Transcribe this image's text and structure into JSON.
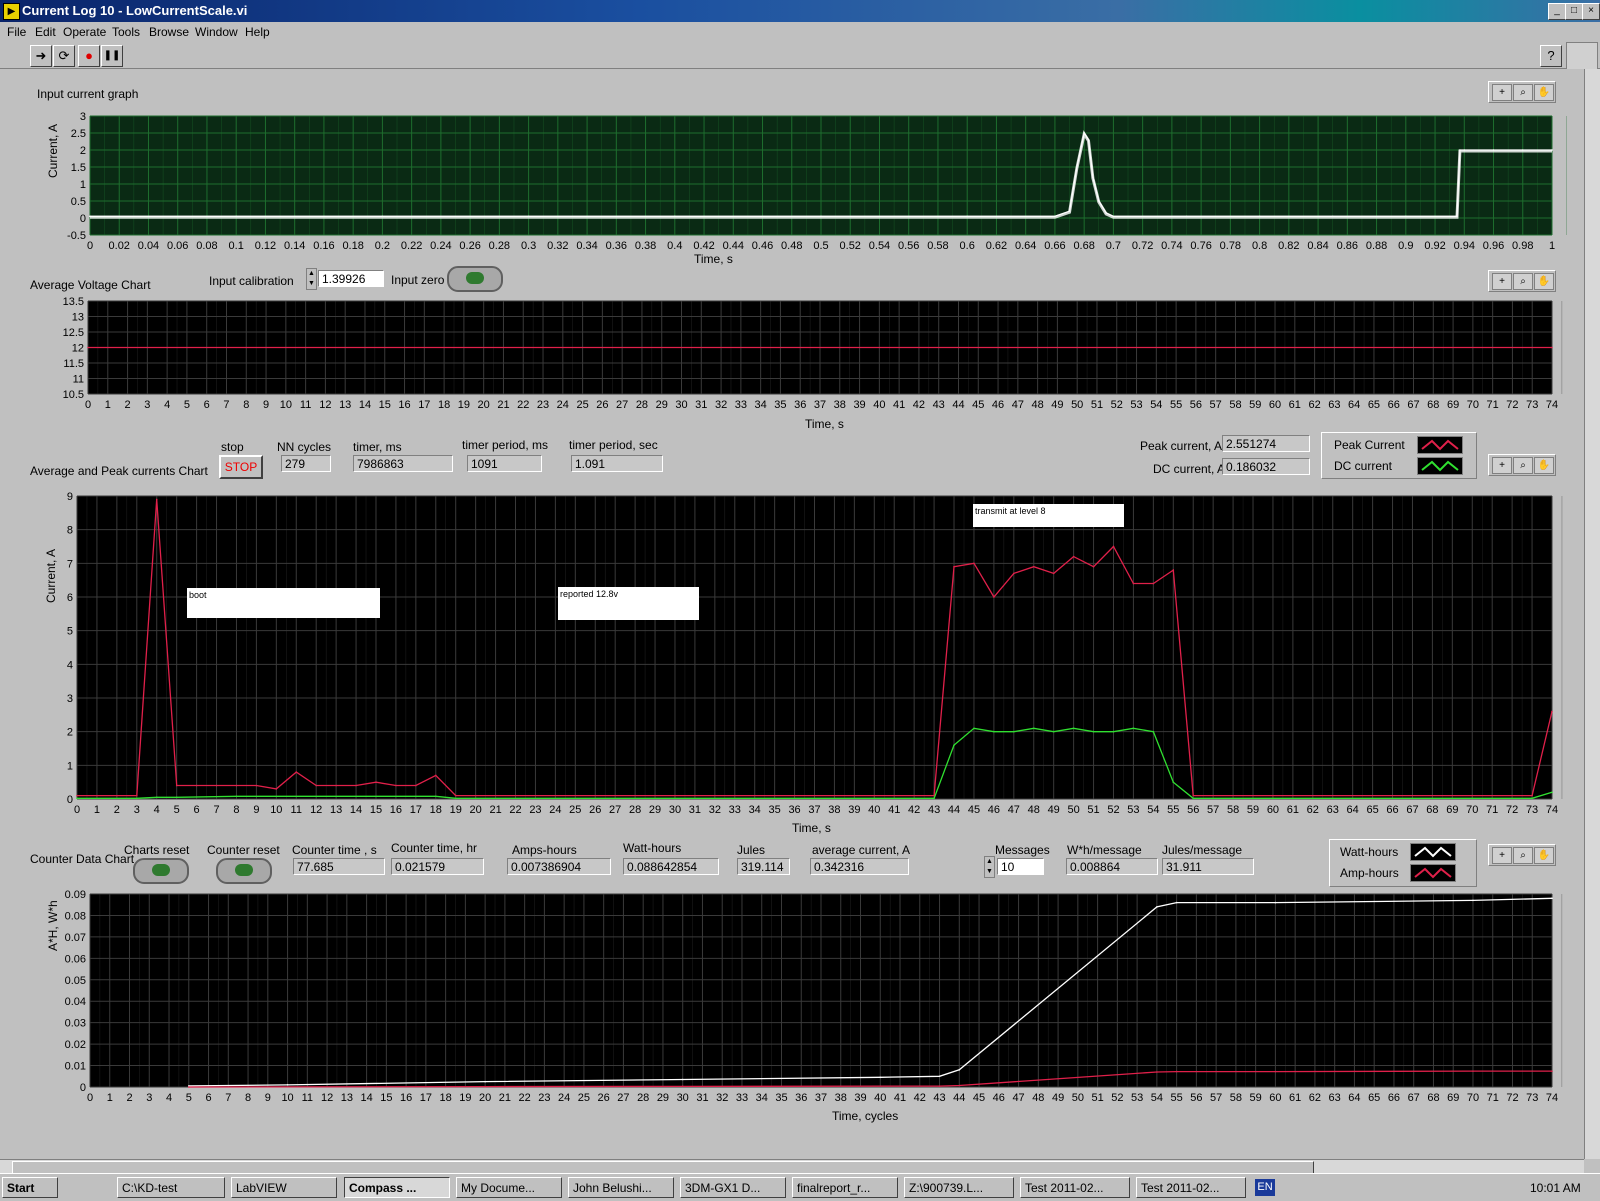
{
  "window": {
    "title": "Current Log 10 - LowCurrentScale.vi",
    "minimize": "_",
    "maximize": "□",
    "close": "×"
  },
  "menu": [
    "File",
    "Edit",
    "Operate",
    "Tools",
    "Browse",
    "Window",
    "Help"
  ],
  "toolbar": {
    "run": "➜",
    "run_continuous": "⟳",
    "abort": "●",
    "pause": "❚❚",
    "help": "?"
  },
  "graph1": {
    "title": "Input current graph",
    "chart_data": {
      "type": "line",
      "title": "Input current graph",
      "xlabel": "Time, s",
      "ylabel": "Current, A",
      "xlim": [
        0,
        1
      ],
      "ylim": [
        -0.5,
        3
      ],
      "xticks": [
        "0",
        "0.02",
        "0.04",
        "0.06",
        "0.08",
        "0.1",
        "0.12",
        "0.14",
        "0.16",
        "0.18",
        "0.2",
        "0.22",
        "0.24",
        "0.26",
        "0.28",
        "0.3",
        "0.32",
        "0.34",
        "0.36",
        "0.38",
        "0.4",
        "0.42",
        "0.44",
        "0.46",
        "0.48",
        "0.5",
        "0.52",
        "0.54",
        "0.56",
        "0.58",
        "0.6",
        "0.62",
        "0.64",
        "0.66",
        "0.68",
        "0.7",
        "0.72",
        "0.74",
        "0.76",
        "0.78",
        "0.8",
        "0.82",
        "0.84",
        "0.86",
        "0.88",
        "0.9",
        "0.92",
        "0.94",
        "0.96",
        "0.98",
        "1"
      ],
      "yticks": [
        "3",
        "2.5",
        "2",
        "1.5",
        "1",
        "0.5",
        "0",
        "-0.5"
      ],
      "series": [
        {
          "color": "#ffffff",
          "x": [
            0,
            0.1,
            0.2,
            0.3,
            0.4,
            0.5,
            0.6,
            0.66,
            0.67,
            0.675,
            0.68,
            0.683,
            0.686,
            0.69,
            0.695,
            0.7,
            0.75,
            0.8,
            0.85,
            0.9,
            0.935,
            0.937,
            0.94,
            0.96,
            0.98,
            1
          ],
          "y": [
            0.05,
            0.05,
            0.05,
            0.05,
            0.05,
            0.05,
            0.05,
            0.05,
            0.2,
            1.5,
            2.5,
            2.3,
            1.2,
            0.5,
            0.15,
            0.05,
            0.05,
            0.05,
            0.05,
            0.05,
            0.05,
            2.0,
            2.0,
            2.0,
            2.0,
            2.0
          ]
        }
      ]
    }
  },
  "graph2": {
    "title": "Average Voltage  Chart",
    "calibration_label": "Input calibration",
    "calibration_value": "1.39926",
    "zero_label": "Input zero",
    "chart_data": {
      "type": "line",
      "title": "Average Voltage  Chart",
      "xlabel": "Time, s",
      "ylabel": "",
      "xlim": [
        0,
        74
      ],
      "ylim": [
        10.5,
        13.5
      ],
      "yticks": [
        "13.5",
        "13",
        "12.5",
        "12",
        "11.5",
        "11",
        "10.5"
      ],
      "series": [
        {
          "color": "#e0204a",
          "x": [
            0,
            74
          ],
          "y": [
            12,
            12
          ]
        }
      ]
    }
  },
  "controls3": {
    "stop_label": "stop",
    "stop_button": "STOP",
    "nn_cycles_label": "NN cycles",
    "nn_cycles": "279",
    "timer_ms_label": "timer, ms",
    "timer_ms": "7986863",
    "timer_period_ms_label": "timer period, ms",
    "timer_period_ms": "1091",
    "timer_period_sec_label": "timer period, sec",
    "timer_period_sec": "1.091",
    "peak_label": "Peak current, A",
    "peak_value": "2.551274",
    "dc_label": "DC current, A",
    "dc_value": "0.186032",
    "legend": [
      "Peak Current",
      "DC current"
    ]
  },
  "graph3": {
    "title": "Average and Peak currents Chart",
    "notes": [
      "boot",
      "reported 12.8v",
      "transmit at level 8"
    ],
    "chart_data": {
      "type": "line",
      "title": "Average and Peak currents Chart",
      "xlabel": "Time, s",
      "ylabel": "Current, A",
      "xlim": [
        0,
        74
      ],
      "ylim": [
        0,
        9
      ],
      "yticks": [
        "9",
        "8",
        "7",
        "6",
        "5",
        "4",
        "3",
        "2",
        "1",
        "0"
      ],
      "series": [
        {
          "name": "Peak Current",
          "color": "#e0204a",
          "x": [
            0,
            1,
            2,
            3,
            4,
            5,
            6,
            7,
            8,
            9,
            10,
            11,
            12,
            13,
            14,
            15,
            16,
            17,
            18,
            19,
            20,
            30,
            40,
            43,
            44,
            45,
            46,
            47,
            48,
            49,
            50,
            51,
            52,
            53,
            54,
            55,
            56,
            60,
            70,
            73,
            74
          ],
          "y": [
            0.1,
            0.1,
            0.1,
            0.1,
            8.9,
            0.4,
            0.4,
            0.4,
            0.4,
            0.4,
            0.3,
            0.8,
            0.4,
            0.4,
            0.4,
            0.5,
            0.4,
            0.4,
            0.7,
            0.1,
            0.1,
            0.1,
            0.1,
            0.1,
            6.9,
            7.0,
            6.0,
            6.7,
            6.9,
            6.7,
            7.2,
            6.9,
            7.5,
            6.4,
            6.4,
            6.8,
            0.1,
            0.1,
            0.1,
            0.1,
            2.6
          ]
        },
        {
          "name": "DC current",
          "color": "#30e030",
          "x": [
            0,
            3,
            4,
            5,
            8,
            18,
            19,
            20,
            30,
            40,
            43,
            44,
            45,
            46,
            47,
            48,
            49,
            50,
            51,
            52,
            53,
            54,
            55,
            56,
            60,
            70,
            73,
            74
          ],
          "y": [
            0.02,
            0.02,
            0.05,
            0.05,
            0.08,
            0.08,
            0.02,
            0.02,
            0.02,
            0.02,
            0.02,
            1.6,
            2.1,
            2.0,
            2.0,
            2.1,
            2.0,
            2.1,
            2.0,
            2.0,
            2.1,
            2.0,
            0.5,
            0.02,
            0.02,
            0.02,
            0.02,
            0.2
          ]
        }
      ]
    }
  },
  "controls4": {
    "charts_reset_label": "Charts reset",
    "counter_reset_label": "Counter reset",
    "counter_time_s_label": "Counter time , s",
    "counter_time_s": "77.685",
    "counter_time_hr_label": "Counter time, hr",
    "counter_time_hr": "0.021579",
    "amp_hours_label": "Amps-hours",
    "amp_hours": "0.007386904",
    "watt_hours_label": "Watt-hours",
    "watt_hours": "0.088642854",
    "jules_label": "Jules",
    "jules": "319.114",
    "avg_current_label": "average current, A",
    "avg_current": "0.342316",
    "messages_label": "Messages",
    "messages": "10",
    "wh_msg_label": "W*h/message",
    "wh_msg": "0.008864",
    "jules_msg_label": "Jules/message",
    "jules_msg": "31.911",
    "legend": [
      "Watt-hours",
      "Amp-hours"
    ]
  },
  "graph4": {
    "title": "Counter Data Chart",
    "chart_data": {
      "type": "line",
      "title": "Counter Data Chart",
      "xlabel": "Time, cycles",
      "ylabel": "A*H, W*h",
      "xlim": [
        0,
        74
      ],
      "ylim": [
        0,
        0.09
      ],
      "yticks": [
        "0.09",
        "0.08",
        "0.07",
        "0.06",
        "0.05",
        "0.04",
        "0.03",
        "0.02",
        "0.01",
        "0"
      ],
      "series": [
        {
          "name": "Watt-hours",
          "color": "#ffffff",
          "x": [
            5,
            10,
            20,
            30,
            40,
            43,
            44,
            54,
            55,
            60,
            70,
            74
          ],
          "y": [
            0.0005,
            0.001,
            0.0025,
            0.0035,
            0.0045,
            0.005,
            0.008,
            0.084,
            0.086,
            0.086,
            0.087,
            0.088
          ]
        },
        {
          "name": "Amp-hours",
          "color": "#e0204a",
          "x": [
            5,
            20,
            30,
            43,
            44,
            54,
            55,
            60,
            70,
            74
          ],
          "y": [
            0.0,
            0.0002,
            0.0003,
            0.0004,
            0.0007,
            0.007,
            0.0072,
            0.0072,
            0.0074,
            0.0074
          ]
        }
      ]
    }
  },
  "taskbar": {
    "start": "Start",
    "tasks": [
      "C:\\KD-test",
      "LabVIEW",
      "Compass ...",
      "My Docume...",
      "John Belushi...",
      "3DM-GX1 D...",
      "finalreport_r...",
      "Z:\\900739.L...",
      "Test 2011-02...",
      "Test 2011-02..."
    ],
    "lang": "EN",
    "clock": "10:01 AM"
  }
}
